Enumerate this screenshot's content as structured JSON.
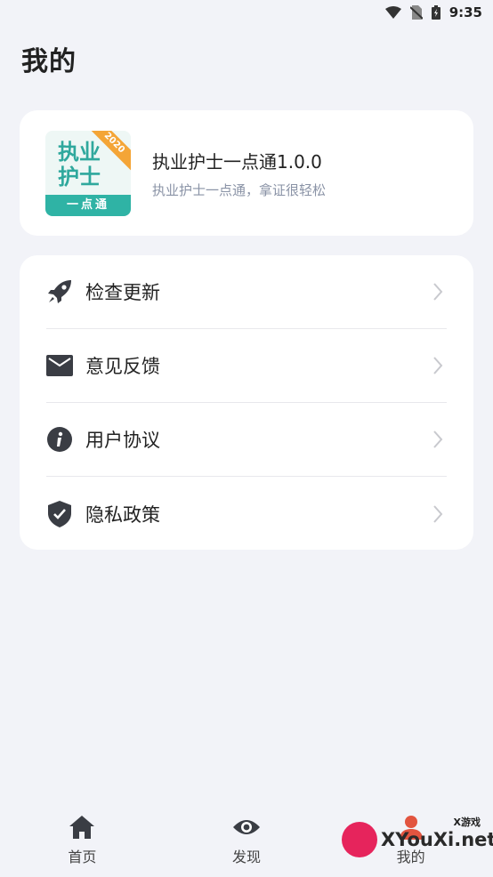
{
  "status_bar": {
    "time": "9:35"
  },
  "page": {
    "title": "我的"
  },
  "app": {
    "logo_text": "执业\n护士",
    "logo_band": "一点通",
    "logo_ribbon": "2020",
    "name": "执业护士一点通1.0.0",
    "slogan": "执业护士一点通，拿证很轻松"
  },
  "menu": {
    "items": [
      {
        "label": "检查更新",
        "icon": "rocket-icon"
      },
      {
        "label": "意见反馈",
        "icon": "mail-icon"
      },
      {
        "label": "用户协议",
        "icon": "info-icon"
      },
      {
        "label": "隐私政策",
        "icon": "shield-check-icon"
      }
    ]
  },
  "tabs": [
    {
      "label": "首页",
      "icon": "home-icon"
    },
    {
      "label": "发现",
      "icon": "eye-icon"
    },
    {
      "label": "我的",
      "icon": "person-icon"
    }
  ],
  "watermark": {
    "text": "XYouXi.net",
    "small": "X游戏"
  },
  "colors": {
    "background": "#f2f3f8",
    "accent": "#2fb3a5",
    "icon": "#3a3d44"
  }
}
